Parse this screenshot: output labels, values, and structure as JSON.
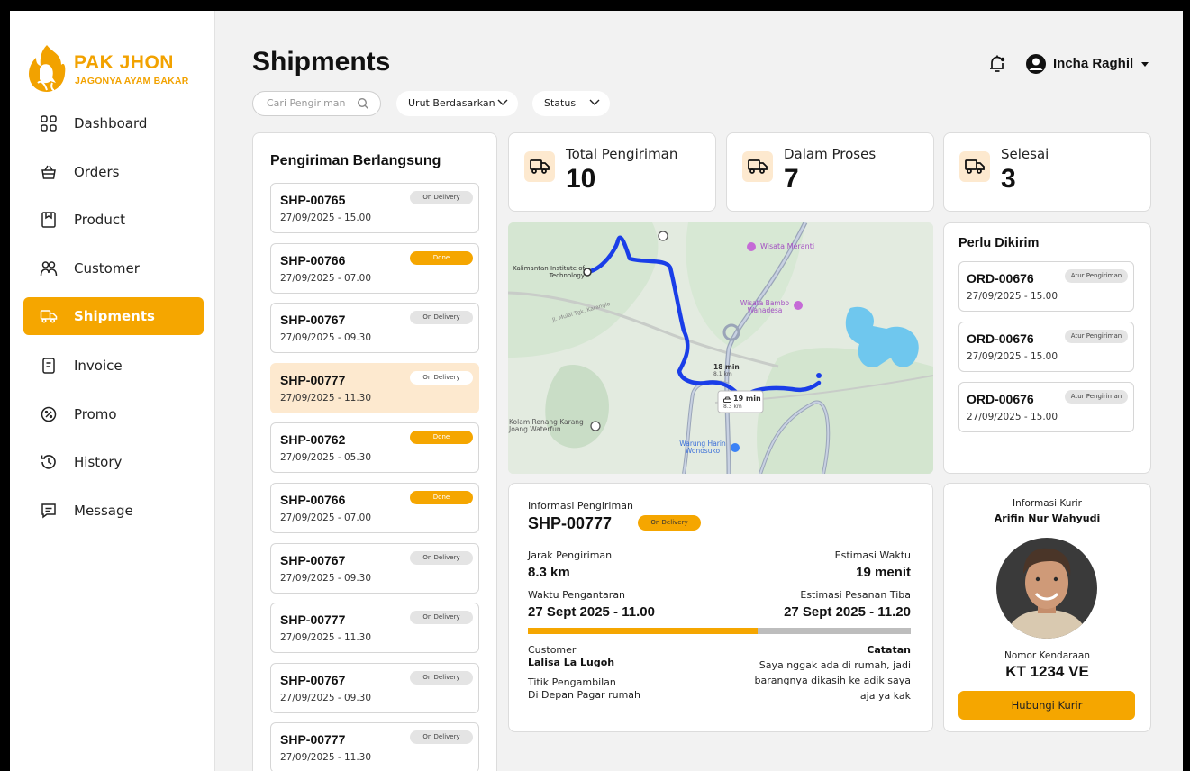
{
  "brand": {
    "name": "PAK JHON",
    "tagline": "JAGONYA AYAM BAKAR"
  },
  "sidebar": {
    "items": [
      {
        "label": "Dashboard",
        "icon": "dashboard-grid-icon"
      },
      {
        "label": "Orders",
        "icon": "basket-icon"
      },
      {
        "label": "Product",
        "icon": "product-box-icon"
      },
      {
        "label": "Customer",
        "icon": "customers-icon"
      },
      {
        "label": "Shipments",
        "icon": "truck-icon",
        "active": true
      },
      {
        "label": "Invoice",
        "icon": "invoice-icon"
      },
      {
        "label": "Promo",
        "icon": "promo-icon"
      },
      {
        "label": "History",
        "icon": "history-icon"
      },
      {
        "label": "Message",
        "icon": "message-icon"
      }
    ]
  },
  "header": {
    "title": "Shipments",
    "search_placeholder": "Cari Pengiriman",
    "sort_label": "Urut Berdasarkan",
    "status_label": "Status",
    "user_name": "Incha Raghil"
  },
  "ongoing": {
    "title": "Pengiriman Berlangsung",
    "items": [
      {
        "id": "SHP-00765",
        "date": "27/09/2025 - 15.00",
        "status": "On Delivery"
      },
      {
        "id": "SHP-00766",
        "date": "27/09/2025 - 07.00",
        "status": "Done"
      },
      {
        "id": "SHP-00767",
        "date": "27/09/2025 - 09.30",
        "status": "On Delivery"
      },
      {
        "id": "SHP-00777",
        "date": "27/09/2025 - 11.30",
        "status": "On Delivery",
        "selected": true
      },
      {
        "id": "SHP-00762",
        "date": "27/09/2025 - 05.30",
        "status": "Done"
      },
      {
        "id": "SHP-00766",
        "date": "27/09/2025 - 07.00",
        "status": "Done"
      },
      {
        "id": "SHP-00767",
        "date": "27/09/2025 - 09.30",
        "status": "On Delivery"
      },
      {
        "id": "SHP-00777",
        "date": "27/09/2025 - 11.30",
        "status": "On Delivery"
      },
      {
        "id": "SHP-00767",
        "date": "27/09/2025 - 09.30",
        "status": "On Delivery"
      },
      {
        "id": "SHP-00777",
        "date": "27/09/2025 - 11.30",
        "status": "On Delivery"
      }
    ]
  },
  "stats": [
    {
      "label": "Total Pengiriman",
      "value": "10"
    },
    {
      "label": "Dalam Proses",
      "value": "7"
    },
    {
      "label": "Selesai",
      "value": "3"
    }
  ],
  "map": {
    "labels": {
      "kit": "Kalimantan Institute of Technology",
      "wisata": "Wisata Meranti",
      "bambu": "Wisata Bambo Wanadesa",
      "kolam": "Kolam Renang Karang Joang Waterfun",
      "warung": "Warung Harin Wonosuko",
      "road": "Jl. Mulai Tgk. Karanglo",
      "duration_alt": "18 min",
      "dist_alt": "8.1 km",
      "duration": "19 min",
      "dist": "8.3 km"
    }
  },
  "to_send": {
    "title": "Perlu Dikirim",
    "items": [
      {
        "id": "ORD-00676",
        "date": "27/09/2025 - 15.00",
        "action": "Atur Pengiriman"
      },
      {
        "id": "ORD-00676",
        "date": "27/09/2025 - 15.00",
        "action": "Atur Pengiriman"
      },
      {
        "id": "ORD-00676",
        "date": "27/09/2025 - 15.00",
        "action": "Atur Pengiriman"
      }
    ]
  },
  "info": {
    "heading": "Informasi Pengiriman",
    "id": "SHP-00777",
    "status": "On Delivery",
    "distance_label": "Jarak Pengiriman",
    "distance": "8.3 km",
    "eta_label": "Estimasi Waktu",
    "eta": "19 menit",
    "delivery_time_label": "Waktu Pengantaran",
    "delivery_time": "27 Sept 2025 - 11.00",
    "arrival_label": "Estimasi Pesanan Tiba",
    "arrival": "27 Sept 2025 - 11.20",
    "progress_percent": 60,
    "customer_label": "Customer",
    "customer": "Lalisa La Lugoh",
    "pickup_label": "Titik Pengambilan",
    "pickup": "Di Depan Pagar rumah",
    "note_label": "Catatan",
    "note_lines": [
      "Saya nggak ada di rumah, jadi",
      "barangnya dikasih ke adik saya",
      "aja ya kak"
    ]
  },
  "courier": {
    "heading": "Informasi Kurir",
    "name": "Arifin Nur Wahyudi",
    "plate_label": "Nomor Kendaraan",
    "plate": "KT 1234 VE",
    "contact_button": "Hubungi Kurir"
  },
  "colors": {
    "accent": "#f5a600",
    "accent_light": "#fde9cf",
    "route": "#1a3ee8"
  }
}
